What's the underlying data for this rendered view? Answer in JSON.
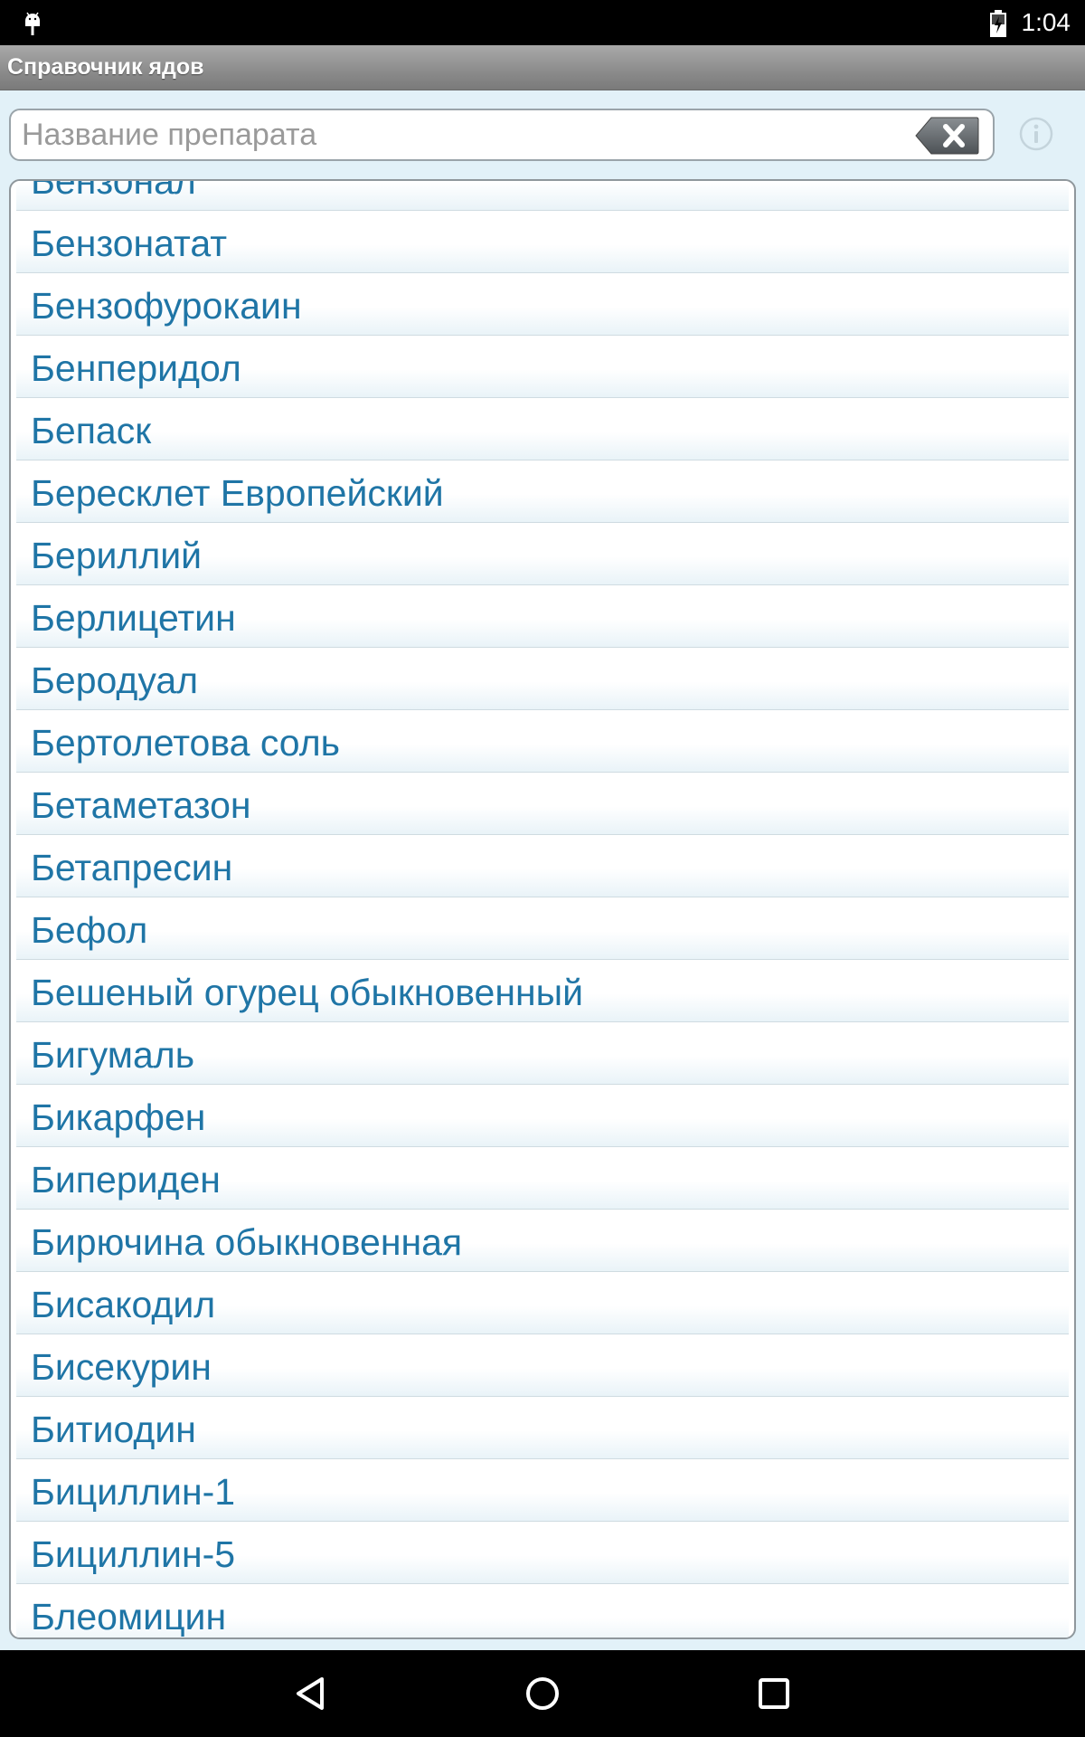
{
  "status_bar": {
    "time": "1:04",
    "icons": [
      "android-notification-icon",
      "battery-charging-icon"
    ]
  },
  "app": {
    "title": "Справочник ядов"
  },
  "search": {
    "placeholder": "Название препарата",
    "value": "",
    "clear_icon": "backspace-clear-icon",
    "info_icon": "info-icon"
  },
  "list": {
    "items": [
      {
        "label": "Бензонал"
      },
      {
        "label": "Бензонатат"
      },
      {
        "label": "Бензофурокаин"
      },
      {
        "label": "Бенперидол"
      },
      {
        "label": "Бепаск"
      },
      {
        "label": "Бересклет Европейский"
      },
      {
        "label": "Бериллий"
      },
      {
        "label": "Берлицетин"
      },
      {
        "label": "Беродуал"
      },
      {
        "label": "Бертолетова соль"
      },
      {
        "label": "Бетаметазон"
      },
      {
        "label": "Бетапресин"
      },
      {
        "label": "Бефол"
      },
      {
        "label": "Бешеный огурец обыкновенный"
      },
      {
        "label": "Бигумаль"
      },
      {
        "label": "Бикарфен"
      },
      {
        "label": "Бипериден"
      },
      {
        "label": "Бирючина обыкновенная"
      },
      {
        "label": "Бисакодил"
      },
      {
        "label": "Бисекурин"
      },
      {
        "label": "Битиодин"
      },
      {
        "label": "Бициллин-1"
      },
      {
        "label": "Бициллин-5"
      },
      {
        "label": "Блеомицин"
      }
    ]
  },
  "nav_bar": {
    "icons": [
      "back-icon",
      "home-icon",
      "recents-icon"
    ]
  },
  "colors": {
    "list_text": "#1f75a6",
    "title_bar": "#8b8b8b",
    "background": "#e2f1f8"
  }
}
